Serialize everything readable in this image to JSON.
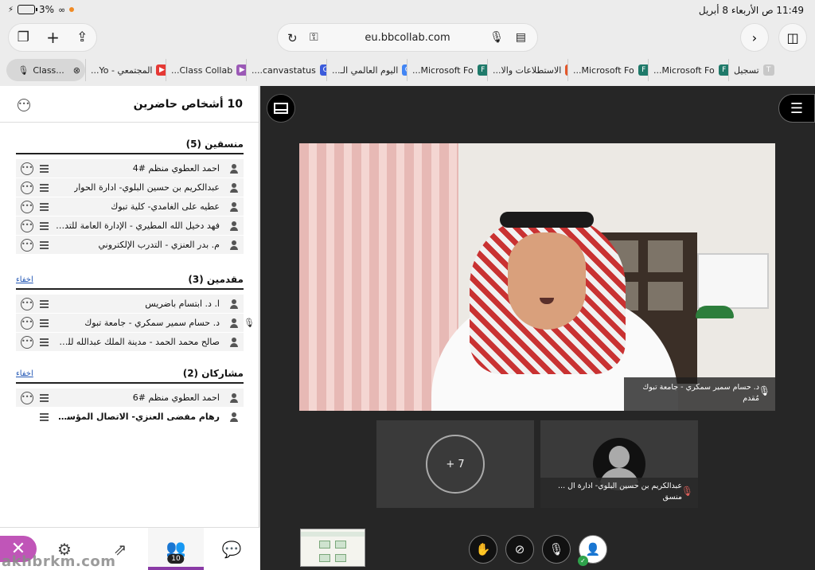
{
  "status_bar": {
    "time": "11:49 ص  الأربعاء 8 أبريل",
    "battery": "3%"
  },
  "browser": {
    "url": "eu.bbcollab.com",
    "tabs": [
      {
        "label": "تسجيل",
        "fav": "T",
        "color": "#c8c8c8"
      },
      {
        "label": "Microsoft Fo...",
        "fav": "F",
        "color": "#1f7a6a"
      },
      {
        "label": "Microsoft Fo...",
        "fav": "F",
        "color": "#1f7a6a"
      },
      {
        "label": "الاستطلاعات والا...",
        "fav": "■",
        "color": "#e3572a"
      },
      {
        "label": "Microsoft Fo...",
        "fav": "F",
        "color": "#1f7a6a"
      },
      {
        "label": "اليوم العالمي الـ...",
        "fav": "G",
        "color": "#4285f4"
      },
      {
        "label": "canvastatus....",
        "fav": "C",
        "color": "#3b5bdb"
      },
      {
        "label": "Class Collab...",
        "fav": "▶",
        "color": "#9b59b6"
      },
      {
        "label": "المجتمعي - Yo...",
        "fav": "▶",
        "color": "#e53935"
      },
      {
        "label": "Class...",
        "fav": "",
        "color": "#d7d7d7"
      }
    ]
  },
  "attendees": {
    "title": "10 أشخاص حاضرين",
    "facilitators": {
      "title": "منسقين (5)",
      "items": [
        "احمد العطوي منظم #4",
        "عبدالكريم بن حسين البلوي- ادارة الحوار",
        "عطيه على الغامدي- كلية تبوك",
        "فهد دخيل الله المطيري - الإدارة العامة للتدريب ا...",
        "م. بدر العنزي - التدرب الإلكتروني"
      ]
    },
    "presenters": {
      "title": "مقدمين (3)",
      "hide": "اخفاء",
      "items": [
        "ا. د. ابتسام باضريس",
        "د. حسام سمير سمكري - جامعة تبوك",
        "صالح محمد الحمد - مدينة الملك عبدالله للطاقة ال..."
      ]
    },
    "participants": {
      "title": "مشاركان (2)",
      "hide": "اخفاء",
      "items": [
        "احمد العطوي منظم #6",
        "رهام مفضى العنزي- الاتصال المؤسسي #3"
      ]
    }
  },
  "nav": {
    "badge": "10"
  },
  "stage": {
    "speaker_name": "د. حسام سمير سمكري - جامعة تبوك",
    "speaker_role": "مُقدم",
    "more_count": "+ 7",
    "tile_name": "عبدالكريم بن حسين البلوي- ادارة ال ...",
    "tile_role": "منسق"
  },
  "watermark": "akhbrkm.com"
}
